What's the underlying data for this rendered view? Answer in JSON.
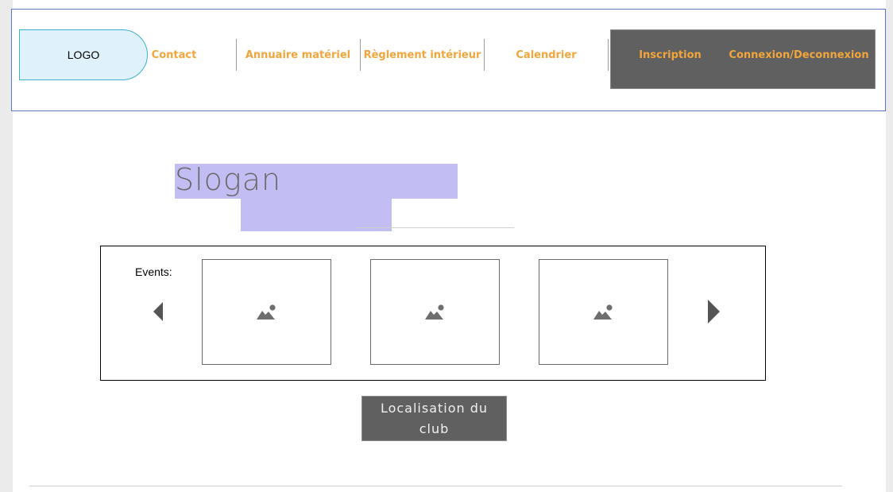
{
  "header": {
    "logo_text": "LOGO",
    "nav": {
      "contact": "Contact",
      "annuaire": "Annuaire matériel",
      "reglement": "Règlement intérieur",
      "calendrier": "Calendrier",
      "inscription": "Inscription",
      "connexion": "Connexion/Deconnexion"
    }
  },
  "hero": {
    "slogan": "Slogan"
  },
  "events": {
    "label": "Events:",
    "cards": [
      {
        "icon": "image-placeholder-icon"
      },
      {
        "icon": "image-placeholder-icon"
      },
      {
        "icon": "image-placeholder-icon"
      }
    ]
  },
  "location_button": {
    "label": "Localisation du club"
  },
  "colors": {
    "nav_text": "#f2a53a",
    "header_border": "#5a74c8",
    "logo_bg": "#dff2fb",
    "slogan_highlight": "#c2bdf3",
    "dark_button": "#606060"
  }
}
